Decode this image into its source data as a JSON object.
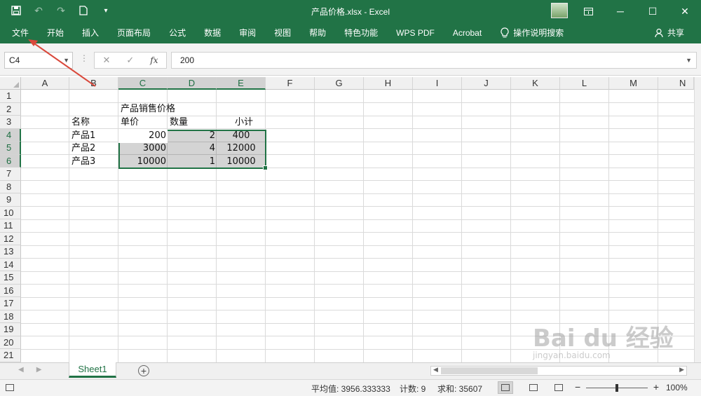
{
  "window": {
    "title": "产品价格.xlsx  -  Excel",
    "qat_icons": [
      "save-icon",
      "undo-icon",
      "redo-icon",
      "new-file-icon",
      "customize-icon"
    ],
    "controls": [
      "ribbon-options-icon",
      "minimize-icon",
      "maximize-icon",
      "close-icon"
    ]
  },
  "ribbon": {
    "tabs": [
      "文件",
      "开始",
      "插入",
      "页面布局",
      "公式",
      "数据",
      "审阅",
      "视图",
      "帮助",
      "特色功能",
      "WPS PDF",
      "Acrobat"
    ],
    "tell_me": "操作说明搜索",
    "share": "共享"
  },
  "formula_bar": {
    "name_box": "C4",
    "formula": "200"
  },
  "columns": [
    "A",
    "B",
    "C",
    "D",
    "E",
    "F",
    "G",
    "H",
    "I",
    "J",
    "K",
    "L",
    "M",
    "N"
  ],
  "rows": [
    "1",
    "2",
    "3",
    "4",
    "5",
    "6",
    "7",
    "8",
    "9",
    "10",
    "11",
    "12",
    "13",
    "14",
    "15",
    "16",
    "17",
    "18",
    "19",
    "20",
    "21"
  ],
  "sheet": {
    "title_cell": "产品销售价格",
    "headers": {
      "name": "名称",
      "price": "单价",
      "qty": "数量",
      "subtotal": "小计"
    },
    "data": [
      {
        "name": "产品1",
        "price": "200",
        "qty": "2",
        "subtotal": "400"
      },
      {
        "name": "产品2",
        "price": "3000",
        "qty": "4",
        "subtotal": "12000"
      },
      {
        "name": "产品3",
        "price": "10000",
        "qty": "1",
        "subtotal": "10000"
      }
    ]
  },
  "sheet_tabs": {
    "active": "Sheet1"
  },
  "status_bar": {
    "average": "平均值: 3956.333333",
    "count": "计数: 9",
    "sum": "求和: 35607",
    "zoom": "100%"
  },
  "colors": {
    "accent": "#217346",
    "annotation": "#d9483b"
  },
  "watermark": {
    "text": "Bai du 经验",
    "sub": "jingyan.baidu.com"
  }
}
